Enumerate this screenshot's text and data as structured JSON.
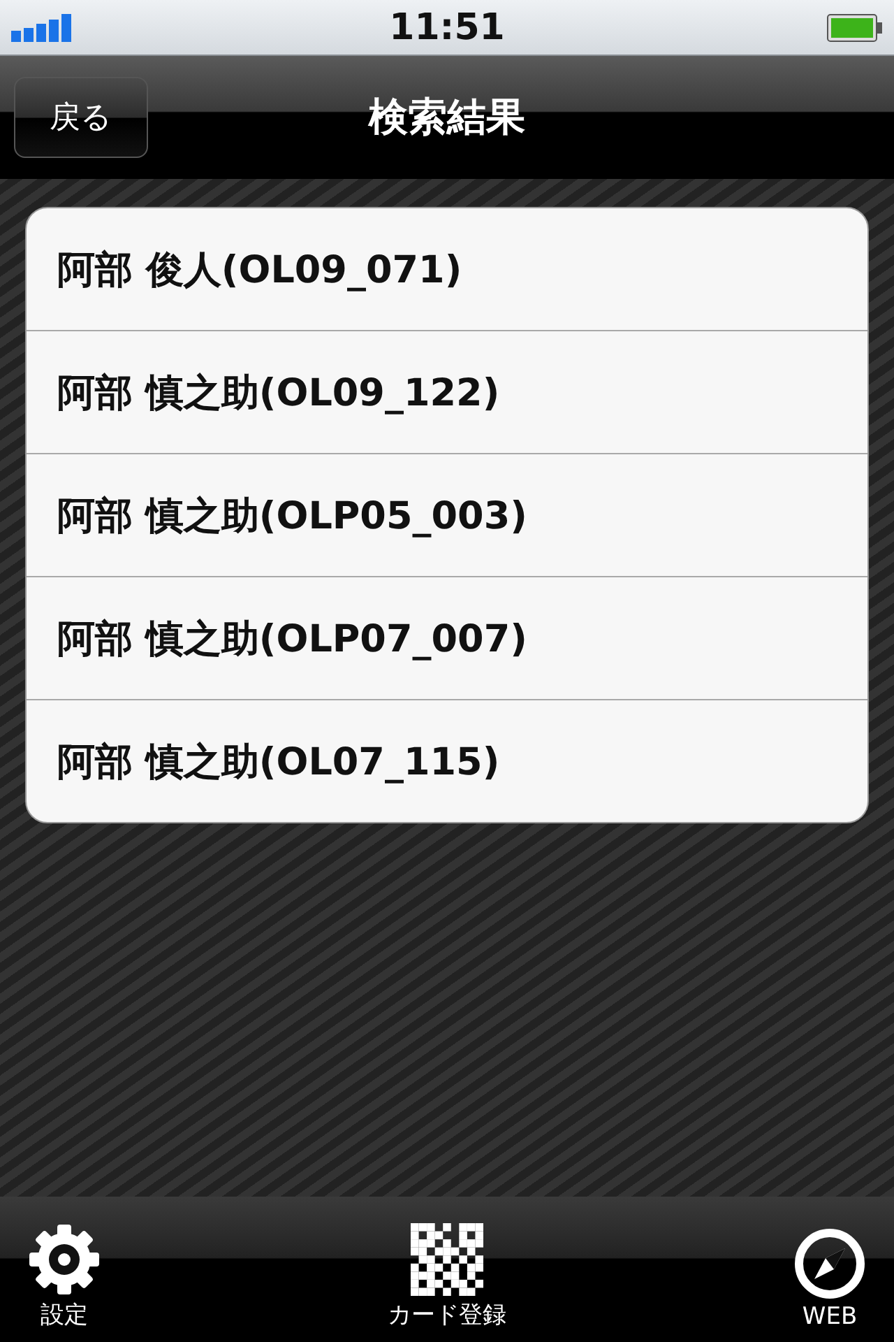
{
  "status_bar": {
    "time": "11:51"
  },
  "nav_bar": {
    "back_button": "戻る",
    "title": "検索結果"
  },
  "results": [
    {
      "label": "阿部 俊人(OL09_071)"
    },
    {
      "label": "阿部 慎之助(OL09_122)"
    },
    {
      "label": "阿部 慎之助(OLP05_003)"
    },
    {
      "label": "阿部 慎之助(OLP07_007)"
    },
    {
      "label": "阿部 慎之助(OL07_115)"
    }
  ],
  "tab_bar": [
    {
      "label": "設定"
    },
    {
      "label": "カード登録"
    },
    {
      "label": "WEB"
    }
  ]
}
